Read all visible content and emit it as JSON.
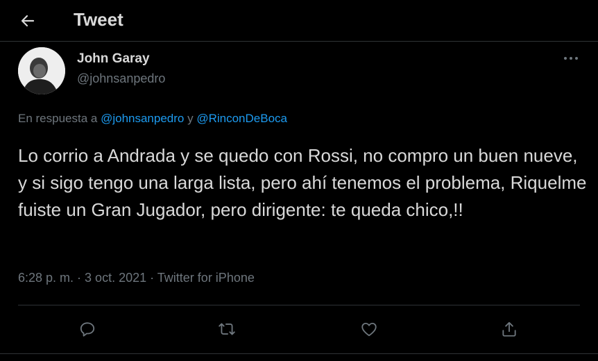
{
  "header": {
    "title": "Tweet",
    "back_icon": "arrow-left-icon"
  },
  "author": {
    "name": "John Garay",
    "handle": "@johnsanpedro"
  },
  "reply": {
    "prefix": "En respuesta a ",
    "mention_1": "@johnsanpedro",
    "conjunction": " y ",
    "mention_2": "@RinconDeBoca"
  },
  "tweet": {
    "text": "Lo corrio a Andrada y se quedo con Rossi, no compro un buen nueve, y si sigo tengo una larga lista, pero ahí tenemos el problema, Riquelme fuiste un Gran Jugador, pero dirigente: te queda chico,!!",
    "time": "6:28 p. m.",
    "separator_1": " · ",
    "date": "3 oct. 2021",
    "separator_2": " · ",
    "source": "Twitter for iPhone"
  },
  "actions": [
    "reply-icon",
    "retweet-icon",
    "like-icon",
    "share-icon"
  ],
  "colors": {
    "background": "#000000",
    "text": "#d9d9d9",
    "secondary": "#6e767d",
    "accent": "#1d9bf0",
    "border": "#2f3336"
  }
}
